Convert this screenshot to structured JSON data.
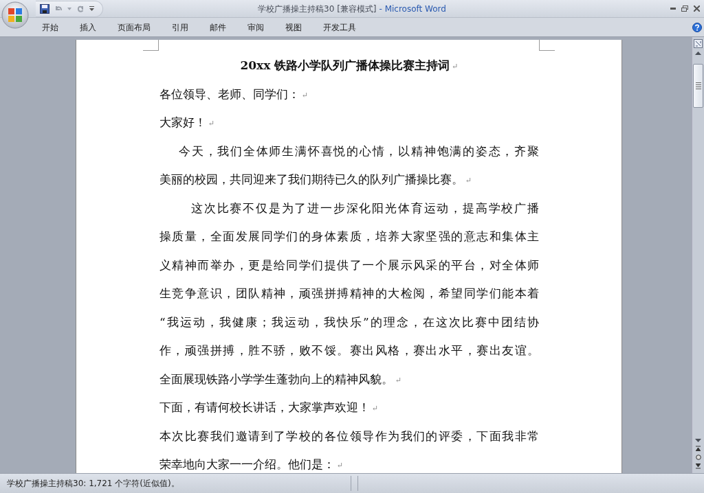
{
  "window": {
    "document_title": "学校广播操主持稿30 [兼容模式]",
    "app_title": "- Microsoft Word"
  },
  "ribbon": {
    "tabs": [
      {
        "label": "开始"
      },
      {
        "label": "插入"
      },
      {
        "label": "页面布局"
      },
      {
        "label": "引用"
      },
      {
        "label": "邮件"
      },
      {
        "label": "审阅"
      },
      {
        "label": "视图"
      },
      {
        "label": "开发工具"
      }
    ]
  },
  "document": {
    "paragraphs": [
      {
        "kind": "heading",
        "lines": [
          "20xx 铁路小学队列广播体操比赛主持词"
        ],
        "mark": "↵"
      },
      {
        "kind": "plain",
        "lines": [
          "各位领导、老师、同学们："
        ],
        "mark": "↵"
      },
      {
        "kind": "plain",
        "lines": [
          "大家好！"
        ],
        "mark": "↵"
      },
      {
        "kind": "indent",
        "lines": [
          "今天，我们全体师生满怀喜悦的心情，以精神饱满的姿态，齐聚",
          "美丽的校园，共同迎来了我们期待已久的队列广播操比赛。"
        ],
        "mark": "↵"
      },
      {
        "kind": "deep-indent",
        "lines": [
          "这次比赛不仅是为了进一步深化阳光体育运动，提高学校广播",
          "操质量，全面发展同学们的身体素质，培养大家坚强的意志和集体主",
          "义精神而举办，更是给同学们提供了一个展示风采的平台，对全体师",
          "生竞争意识，团队精神，顽强拼搏精神的大检阅，希望同学们能本着",
          "“我运动，我健康；我运动，我快乐”的理念，在这次比赛中团结协",
          "作，顽强拼搏，胜不骄，败不馁。赛出风格，赛出水平，赛出友谊。",
          "全面展现铁路小学学生蓬勃向上的精神风貌。"
        ],
        "mark": "↵"
      },
      {
        "kind": "plain",
        "lines": [
          "下面，有请何校长讲话，大家掌声欢迎！"
        ],
        "mark": "↵"
      },
      {
        "kind": "plain",
        "lines": [
          "本次比赛我们邀请到了学校的各位领导作为我们的评委，下面我非常",
          "荣幸地向大家一一介绍。他们是："
        ],
        "mark": "↵"
      }
    ]
  },
  "status_bar": {
    "text": "学校广播操主持稿30: 1,721 个字符(近似值)。"
  }
}
